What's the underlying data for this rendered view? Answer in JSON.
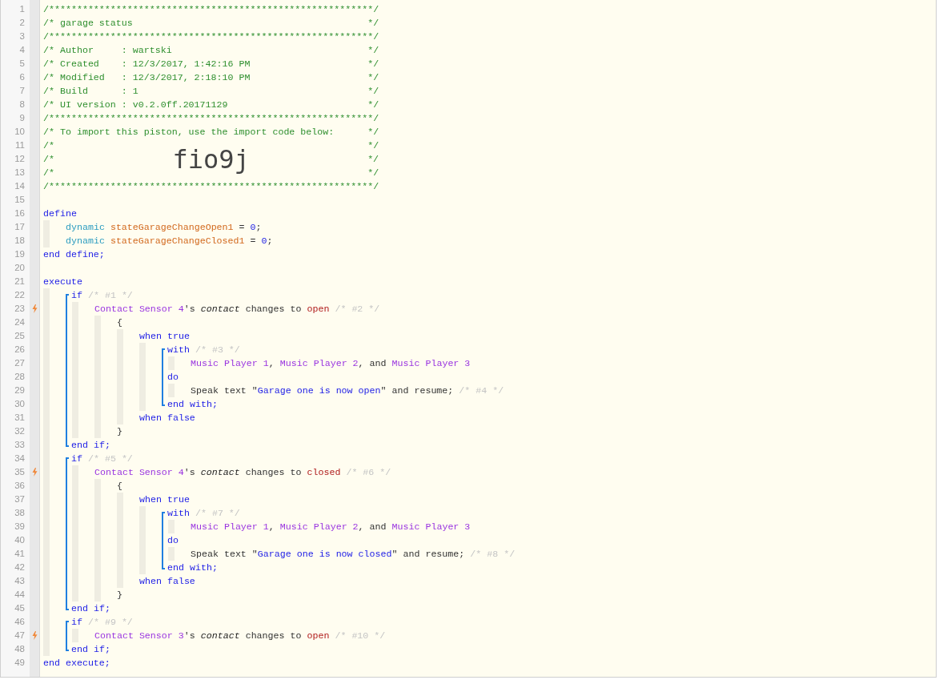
{
  "editor": {
    "lines": [
      {
        "number": "1",
        "trigger": false,
        "tokens": [
          {
            "text": "/**********************************************************/",
            "kind": "comment"
          }
        ]
      },
      {
        "number": "2",
        "trigger": false,
        "tokens": [
          {
            "text": "/* garage status",
            "kind": "comment"
          },
          {
            "text": "*/",
            "kind": "comment_end"
          }
        ]
      },
      {
        "number": "3",
        "trigger": false,
        "tokens": [
          {
            "text": "/**********************************************************/",
            "kind": "comment"
          }
        ]
      },
      {
        "number": "4",
        "trigger": false,
        "tokens": [
          {
            "text": "/* Author     : wartski",
            "kind": "comment"
          },
          {
            "text": "*/",
            "kind": "comment_end"
          }
        ]
      },
      {
        "number": "5",
        "trigger": false,
        "tokens": [
          {
            "text": "/* Created    : 12/3/2017, 1:42:16 PM",
            "kind": "comment"
          },
          {
            "text": "*/",
            "kind": "comment_end"
          }
        ]
      },
      {
        "number": "6",
        "trigger": false,
        "tokens": [
          {
            "text": "/* Modified   : 12/3/2017, 2:18:10 PM",
            "kind": "comment"
          },
          {
            "text": "*/",
            "kind": "comment_end"
          }
        ]
      },
      {
        "number": "7",
        "trigger": false,
        "tokens": [
          {
            "text": "/* Build      : 1",
            "kind": "comment"
          },
          {
            "text": "*/",
            "kind": "comment_end"
          }
        ]
      },
      {
        "number": "8",
        "trigger": false,
        "tokens": [
          {
            "text": "/* UI version : v0.2.0ff.20171129",
            "kind": "comment"
          },
          {
            "text": "*/",
            "kind": "comment_end"
          }
        ]
      },
      {
        "number": "9",
        "trigger": false,
        "tokens": [
          {
            "text": "/**********************************************************/",
            "kind": "comment"
          }
        ]
      },
      {
        "number": "10",
        "trigger": false,
        "tokens": [
          {
            "text": "/* To import this piston, use the import code below:",
            "kind": "comment"
          },
          {
            "text": "*/",
            "kind": "comment_end"
          }
        ]
      },
      {
        "number": "11",
        "trigger": false,
        "tokens": [
          {
            "text": "/*",
            "kind": "comment"
          },
          {
            "text": "*/",
            "kind": "comment_end"
          }
        ]
      },
      {
        "number": "12",
        "trigger": false,
        "tokens": [
          {
            "text": "/*",
            "kind": "comment"
          },
          {
            "text": "fio9j",
            "kind": "import_code"
          },
          {
            "text": "*/",
            "kind": "comment_end"
          }
        ]
      },
      {
        "number": "13",
        "trigger": false,
        "tokens": [
          {
            "text": "/*",
            "kind": "comment"
          },
          {
            "text": "*/",
            "kind": "comment_end"
          }
        ]
      },
      {
        "number": "14",
        "trigger": false,
        "tokens": [
          {
            "text": "/**********************************************************/",
            "kind": "comment"
          }
        ]
      },
      {
        "number": "15",
        "trigger": false
      },
      {
        "number": "16",
        "trigger": false,
        "bracket": false,
        "tokens": [
          {
            "text": "define",
            "kind": "keyword"
          }
        ],
        "children": [
          {
            "number": "17",
            "trigger": false,
            "tokens": [
              {
                "text": "dynamic",
                "kind": "type"
              },
              {
                "text": " stateGarageChangeOpen1",
                "kind": "variable"
              },
              {
                "text": " = ",
                "kind": "plain"
              },
              {
                "text": "0",
                "kind": "number"
              },
              {
                "text": ";",
                "kind": "plain"
              }
            ]
          },
          {
            "number": "18",
            "trigger": false,
            "tokens": [
              {
                "text": "dynamic",
                "kind": "type"
              },
              {
                "text": " stateGarageChangeClosed1",
                "kind": "variable"
              },
              {
                "text": " = ",
                "kind": "plain"
              },
              {
                "text": "0",
                "kind": "number"
              },
              {
                "text": ";",
                "kind": "plain"
              }
            ]
          }
        ],
        "end": {
          "number": "19",
          "tokens": [
            {
              "text": "end define;",
              "kind": "keyword"
            }
          ]
        }
      },
      {
        "number": "20",
        "trigger": false
      },
      {
        "number": "21",
        "trigger": false,
        "bracket": false,
        "tokens": [
          {
            "text": "execute",
            "kind": "keyword"
          }
        ],
        "children": [
          {
            "number": "22",
            "trigger": false,
            "bracket": true,
            "tokens": [
              {
                "text": "if",
                "kind": "keyword"
              },
              {
                "text": " /* #1 */",
                "kind": "note"
              }
            ],
            "children": [
              {
                "number": "23",
                "trigger": true,
                "bracket": false,
                "tokens": [
                  {
                    "text": "Contact Sensor 4",
                    "kind": "device"
                  },
                  {
                    "text": "'s ",
                    "kind": "plain"
                  },
                  {
                    "text": "contact",
                    "kind": "attribute"
                  },
                  {
                    "text": " changes to ",
                    "kind": "plain"
                  },
                  {
                    "text": "open",
                    "kind": "value"
                  },
                  {
                    "text": " /* #2 */",
                    "kind": "note"
                  }
                ],
                "children": [
                  {
                    "number": "24",
                    "trigger": false,
                    "bracket": false,
                    "tokens": [
                      {
                        "text": "{",
                        "kind": "plain"
                      }
                    ],
                    "children": [
                      {
                        "number": "25",
                        "trigger": false,
                        "bracket": false,
                        "tokens": [
                          {
                            "text": "when true",
                            "kind": "keyword"
                          }
                        ],
                        "children": [
                          {
                            "number": "26",
                            "trigger": false,
                            "bracket": true,
                            "tokens": [
                              {
                                "text": "with",
                                "kind": "keyword"
                              },
                              {
                                "text": " /* #3 */",
                                "kind": "note"
                              }
                            ],
                            "children": [
                              {
                                "number": "27",
                                "trigger": false,
                                "tokens": [
                                  {
                                    "text": "Music Player 1",
                                    "kind": "device"
                                  },
                                  {
                                    "text": ", ",
                                    "kind": "plain"
                                  },
                                  {
                                    "text": "Music Player 2",
                                    "kind": "device"
                                  },
                                  {
                                    "text": ", and ",
                                    "kind": "plain"
                                  },
                                  {
                                    "text": "Music Player 3",
                                    "kind": "device"
                                  }
                                ]
                              }
                            ],
                            "clauses": [
                              {
                                "number": "28",
                                "trigger": false,
                                "tokens": [
                                  {
                                    "text": "do",
                                    "kind": "keyword"
                                  }
                                ],
                                "children": [
                                  {
                                    "number": "29",
                                    "trigger": false,
                                    "tokens": [
                                      {
                                        "text": "Speak text \"",
                                        "kind": "plain"
                                      },
                                      {
                                        "text": "Garage one is now open",
                                        "kind": "string"
                                      },
                                      {
                                        "text": "\" and resume; ",
                                        "kind": "plain"
                                      },
                                      {
                                        "text": "/* #4 */",
                                        "kind": "note"
                                      }
                                    ]
                                  }
                                ]
                              }
                            ],
                            "end": {
                              "number": "30",
                              "tokens": [
                                {
                                  "text": "end with;",
                                  "kind": "keyword"
                                }
                              ]
                            }
                          }
                        ]
                      },
                      {
                        "number": "31",
                        "trigger": false,
                        "tokens": [
                          {
                            "text": "when false",
                            "kind": "keyword"
                          }
                        ]
                      }
                    ],
                    "end": {
                      "number": "32",
                      "tokens": [
                        {
                          "text": "}",
                          "kind": "plain"
                        }
                      ]
                    }
                  }
                ]
              }
            ],
            "end": {
              "number": "33",
              "tokens": [
                {
                  "text": "end if;",
                  "kind": "keyword"
                }
              ]
            }
          },
          {
            "number": "34",
            "trigger": false,
            "bracket": true,
            "tokens": [
              {
                "text": "if",
                "kind": "keyword"
              },
              {
                "text": " /* #5 */",
                "kind": "note"
              }
            ],
            "children": [
              {
                "number": "35",
                "trigger": true,
                "bracket": false,
                "tokens": [
                  {
                    "text": "Contact Sensor 4",
                    "kind": "device"
                  },
                  {
                    "text": "'s ",
                    "kind": "plain"
                  },
                  {
                    "text": "contact",
                    "kind": "attribute"
                  },
                  {
                    "text": " changes to ",
                    "kind": "plain"
                  },
                  {
                    "text": "closed",
                    "kind": "value"
                  },
                  {
                    "text": " /* #6 */",
                    "kind": "note"
                  }
                ],
                "children": [
                  {
                    "number": "36",
                    "trigger": false,
                    "bracket": false,
                    "tokens": [
                      {
                        "text": "{",
                        "kind": "plain"
                      }
                    ],
                    "children": [
                      {
                        "number": "37",
                        "trigger": false,
                        "bracket": false,
                        "tokens": [
                          {
                            "text": "when true",
                            "kind": "keyword"
                          }
                        ],
                        "children": [
                          {
                            "number": "38",
                            "trigger": false,
                            "bracket": true,
                            "tokens": [
                              {
                                "text": "with",
                                "kind": "keyword"
                              },
                              {
                                "text": " /* #7 */",
                                "kind": "note"
                              }
                            ],
                            "children": [
                              {
                                "number": "39",
                                "trigger": false,
                                "tokens": [
                                  {
                                    "text": "Music Player 1",
                                    "kind": "device"
                                  },
                                  {
                                    "text": ", ",
                                    "kind": "plain"
                                  },
                                  {
                                    "text": "Music Player 2",
                                    "kind": "device"
                                  },
                                  {
                                    "text": ", and ",
                                    "kind": "plain"
                                  },
                                  {
                                    "text": "Music Player 3",
                                    "kind": "device"
                                  }
                                ]
                              }
                            ],
                            "clauses": [
                              {
                                "number": "40",
                                "trigger": false,
                                "tokens": [
                                  {
                                    "text": "do",
                                    "kind": "keyword"
                                  }
                                ],
                                "children": [
                                  {
                                    "number": "41",
                                    "trigger": false,
                                    "tokens": [
                                      {
                                        "text": "Speak text \"",
                                        "kind": "plain"
                                      },
                                      {
                                        "text": "Garage one is now closed",
                                        "kind": "string"
                                      },
                                      {
                                        "text": "\" and resume; ",
                                        "kind": "plain"
                                      },
                                      {
                                        "text": "/* #8 */",
                                        "kind": "note"
                                      }
                                    ]
                                  }
                                ]
                              }
                            ],
                            "end": {
                              "number": "42",
                              "tokens": [
                                {
                                  "text": "end with;",
                                  "kind": "keyword"
                                }
                              ]
                            }
                          }
                        ]
                      },
                      {
                        "number": "43",
                        "trigger": false,
                        "tokens": [
                          {
                            "text": "when false",
                            "kind": "keyword"
                          }
                        ]
                      }
                    ],
                    "end": {
                      "number": "44",
                      "tokens": [
                        {
                          "text": "}",
                          "kind": "plain"
                        }
                      ]
                    }
                  }
                ]
              }
            ],
            "end": {
              "number": "45",
              "tokens": [
                {
                  "text": "end if;",
                  "kind": "keyword"
                }
              ]
            }
          },
          {
            "number": "46",
            "trigger": false,
            "bracket": true,
            "tokens": [
              {
                "text": "if",
                "kind": "keyword"
              },
              {
                "text": " /* #9 */",
                "kind": "note"
              }
            ],
            "children": [
              {
                "number": "47",
                "trigger": true,
                "tokens": [
                  {
                    "text": "Contact Sensor 3",
                    "kind": "device"
                  },
                  {
                    "text": "'s ",
                    "kind": "plain"
                  },
                  {
                    "text": "contact",
                    "kind": "attribute"
                  },
                  {
                    "text": " changes to ",
                    "kind": "plain"
                  },
                  {
                    "text": "open",
                    "kind": "value"
                  },
                  {
                    "text": " /* #10 */",
                    "kind": "note"
                  }
                ]
              }
            ],
            "end": {
              "number": "48",
              "tokens": [
                {
                  "text": "end if;",
                  "kind": "keyword"
                }
              ]
            }
          }
        ],
        "end": {
          "number": "49",
          "tokens": [
            {
              "text": "end execute;",
              "kind": "keyword"
            }
          ]
        }
      }
    ]
  }
}
